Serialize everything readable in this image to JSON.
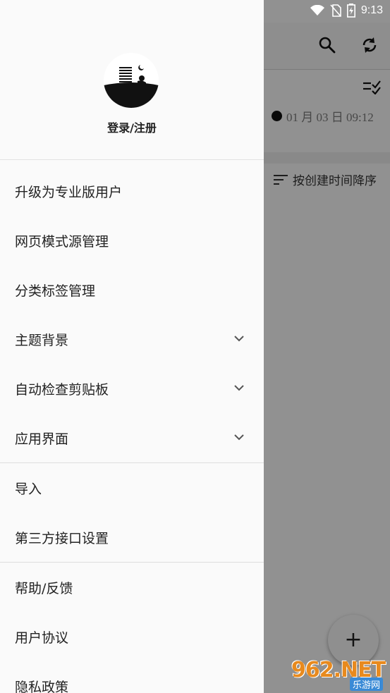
{
  "status_bar": {
    "time": "9:13"
  },
  "background_app": {
    "note_date": "01 月 03 日 09:12",
    "sort_label": "按创建时间降序",
    "fab_symbol": "+"
  },
  "drawer": {
    "login_label": "登录/注册",
    "menu_group_1": [
      {
        "label": "升级为专业版用户"
      },
      {
        "label": "网页模式源管理"
      },
      {
        "label": "分类标签管理"
      },
      {
        "label": "主题背景"
      },
      {
        "label": "自动检查剪贴板"
      },
      {
        "label": "应用界面"
      }
    ],
    "menu_group_2": [
      {
        "label": "导入"
      },
      {
        "label": "第三方接口设置"
      }
    ],
    "menu_group_3": [
      {
        "label": "帮助/反馈"
      },
      {
        "label": "用户协议"
      },
      {
        "label": "隐私政策"
      }
    ]
  },
  "watermark": {
    "main": "962.NET",
    "sub": "乐游网"
  },
  "colors": {
    "drawer_bg": "#fafafa",
    "scrim": "rgba(0,0,0,0.42)",
    "text": "#222222",
    "watermark": "#e88a1e"
  }
}
